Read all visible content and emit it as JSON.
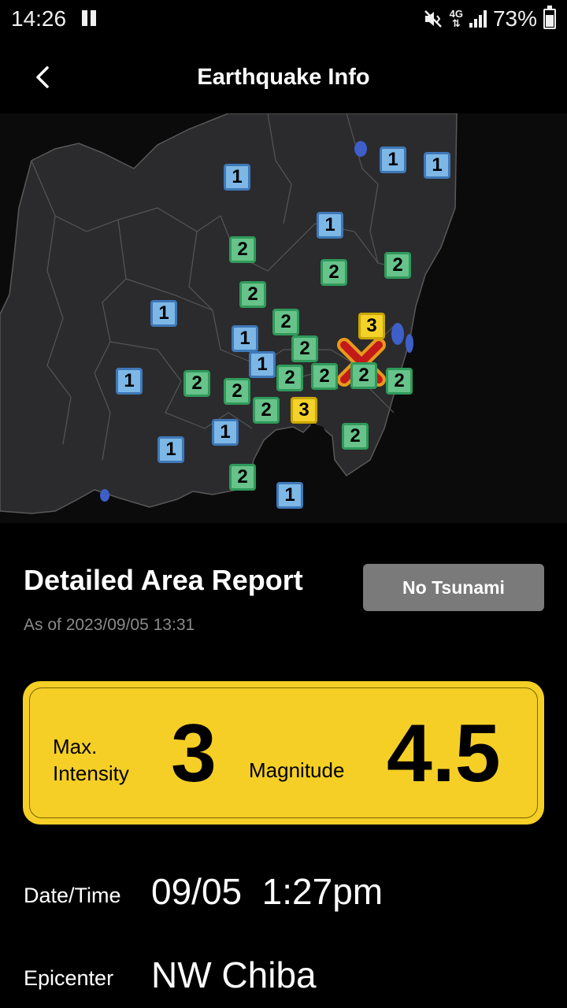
{
  "status_bar": {
    "time": "14:26",
    "network": "4G",
    "battery": "73%"
  },
  "header": {
    "title": "Earthquake Info",
    "back_icon": "chevron-left-icon"
  },
  "map": {
    "intensity_colors": {
      "1": "#7db7e6",
      "2": "#67c38a",
      "3": "#f5d22a"
    },
    "epicenter_marker": "x-mark-icon",
    "markers": [
      "1",
      "1",
      "1",
      "1",
      "2",
      "2",
      "2",
      "2",
      "1",
      "2",
      "3",
      "1",
      "2",
      "1",
      "1",
      "2",
      "2",
      "2",
      "2",
      "2",
      "2",
      "2",
      "3",
      "1",
      "2",
      "1",
      "2",
      "1"
    ]
  },
  "report": {
    "title": "Detailed Area Report",
    "tsunami_label": "No Tsunami",
    "as_of": "As of 2023/09/05  13:31"
  },
  "summary": {
    "max_intensity_label": "Max.\nIntensity",
    "max_intensity_value": "3",
    "magnitude_label": "Magnitude",
    "magnitude_value": "4.5",
    "accent_color": "#f5cf26"
  },
  "details": {
    "datetime_label": "Date/Time",
    "datetime_value": "09/05  1:27pm",
    "epicenter_label": "Epicenter",
    "epicenter_value": "NW Chiba"
  }
}
